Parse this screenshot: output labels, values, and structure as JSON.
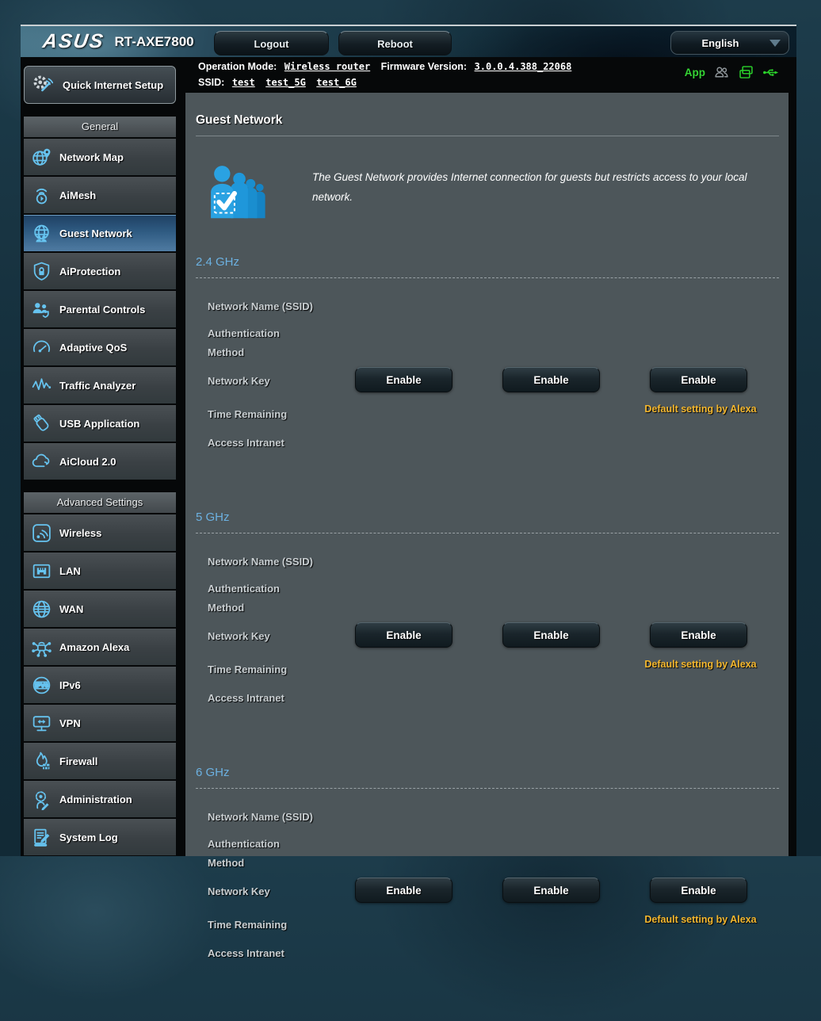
{
  "header": {
    "brand": "ASUS",
    "model": "RT-AXE7800",
    "logout_label": "Logout",
    "reboot_label": "Reboot",
    "language": "English"
  },
  "infobar": {
    "operation_mode_label": "Operation Mode:",
    "operation_mode_value": "Wireless router",
    "firmware_label": "Firmware Version:",
    "firmware_value": "3.0.0.4.388_22068",
    "ssid_label": "SSID:",
    "ssids": [
      "test",
      "test_5G",
      "test_6G"
    ],
    "app_label": "App",
    "icons": [
      "users-icon",
      "device-sync-icon",
      "usb-plug-icon"
    ]
  },
  "sidebar": {
    "qis_label": "Quick Internet Setup",
    "general_header": "General",
    "general_items": [
      {
        "label": "Network Map",
        "icon": "network-map-icon"
      },
      {
        "label": "AiMesh",
        "icon": "aimesh-icon"
      },
      {
        "label": "Guest Network",
        "icon": "guest-network-icon",
        "active": true
      },
      {
        "label": "AiProtection",
        "icon": "aiprotection-icon"
      },
      {
        "label": "Parental Controls",
        "icon": "parental-controls-icon"
      },
      {
        "label": "Adaptive QoS",
        "icon": "adaptive-qos-icon"
      },
      {
        "label": "Traffic Analyzer",
        "icon": "traffic-analyzer-icon"
      },
      {
        "label": "USB Application",
        "icon": "usb-application-icon"
      },
      {
        "label": "AiCloud 2.0",
        "icon": "aicloud-icon"
      }
    ],
    "advanced_header": "Advanced Settings",
    "advanced_items": [
      {
        "label": "Wireless",
        "icon": "wireless-icon"
      },
      {
        "label": "LAN",
        "icon": "lan-icon"
      },
      {
        "label": "WAN",
        "icon": "wan-icon"
      },
      {
        "label": "Amazon Alexa",
        "icon": "amazon-alexa-icon"
      },
      {
        "label": "IPv6",
        "icon": "ipv6-icon"
      },
      {
        "label": "VPN",
        "icon": "vpn-icon"
      },
      {
        "label": "Firewall",
        "icon": "firewall-icon"
      },
      {
        "label": "Administration",
        "icon": "administration-icon"
      },
      {
        "label": "System Log",
        "icon": "system-log-icon"
      }
    ]
  },
  "main": {
    "title": "Guest Network",
    "description": "The Guest Network provides Internet connection for guests but restricts access to your local network.",
    "row_labels": [
      "Network Name (SSID)",
      "Authentication Method",
      "Network Key",
      "Time Remaining",
      "Access Intranet"
    ],
    "enable_label": "Enable",
    "alexa_note": "Default setting by Alexa",
    "sections": [
      {
        "title": "2.4 GHz"
      },
      {
        "title": "5 GHz"
      },
      {
        "title": "6 GHz"
      }
    ]
  },
  "colors": {
    "accent_blue": "#66c3ef",
    "section_title_blue": "#6cb1e1",
    "alexa_gold": "#f4b72e",
    "status_green": "#2bd42b",
    "panel_bg": "#4d565a",
    "active_item_blue": "#2f5b82"
  }
}
